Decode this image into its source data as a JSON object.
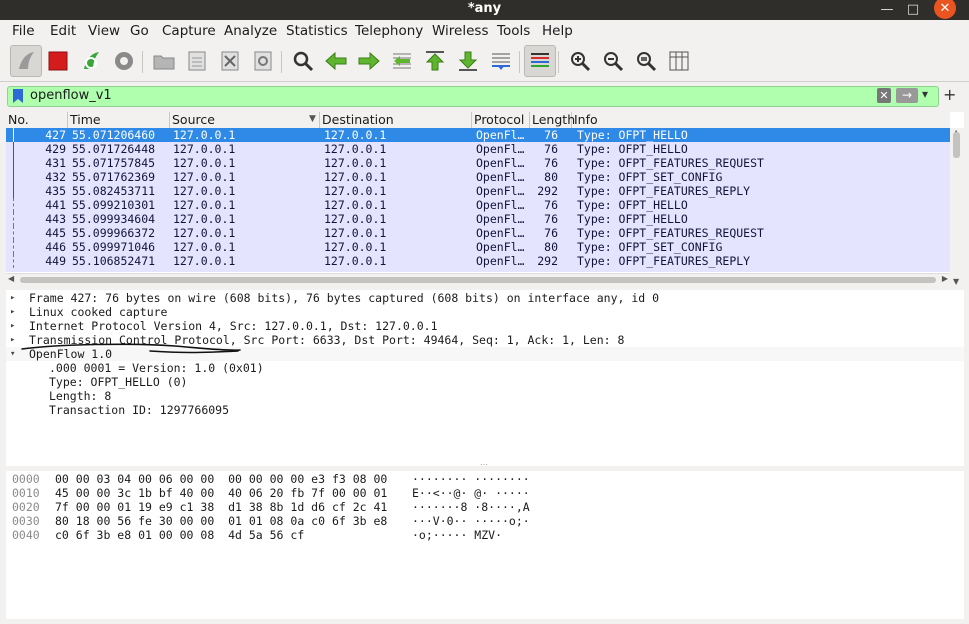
{
  "window": {
    "title": "*any",
    "minimize": "—",
    "maximize": "□",
    "close": "✕"
  },
  "menu": [
    "File",
    "Edit",
    "View",
    "Go",
    "Capture",
    "Analyze",
    "Statistics",
    "Telephony",
    "Wireless",
    "Tools",
    "Help"
  ],
  "filter": {
    "value": "openflow_v1",
    "clear_icon": "✕",
    "apply_icon": "→",
    "dropdown_icon": "▾",
    "add_icon": "+"
  },
  "columns": [
    "No.",
    "Time",
    "Source",
    "Destination",
    "Protocol",
    "Length",
    "Info"
  ],
  "packets": [
    {
      "no": "427",
      "time": "55.071206460",
      "src": "127.0.0.1",
      "dst": "127.0.0.1",
      "proto": "OpenFl…",
      "len": "76",
      "info": "Type: OFPT_HELLO",
      "selected": true
    },
    {
      "no": "429",
      "time": "55.071726448",
      "src": "127.0.0.1",
      "dst": "127.0.0.1",
      "proto": "OpenFl…",
      "len": "76",
      "info": "Type: OFPT_HELLO"
    },
    {
      "no": "431",
      "time": "55.071757845",
      "src": "127.0.0.1",
      "dst": "127.0.0.1",
      "proto": "OpenFl…",
      "len": "76",
      "info": "Type: OFPT_FEATURES_REQUEST"
    },
    {
      "no": "432",
      "time": "55.071762369",
      "src": "127.0.0.1",
      "dst": "127.0.0.1",
      "proto": "OpenFl…",
      "len": "80",
      "info": "Type: OFPT_SET_CONFIG"
    },
    {
      "no": "435",
      "time": "55.082453711",
      "src": "127.0.0.1",
      "dst": "127.0.0.1",
      "proto": "OpenFl…",
      "len": "292",
      "info": "Type: OFPT_FEATURES_REPLY"
    },
    {
      "no": "441",
      "time": "55.099210301",
      "src": "127.0.0.1",
      "dst": "127.0.0.1",
      "proto": "OpenFl…",
      "len": "76",
      "info": "Type: OFPT_HELLO"
    },
    {
      "no": "443",
      "time": "55.099934604",
      "src": "127.0.0.1",
      "dst": "127.0.0.1",
      "proto": "OpenFl…",
      "len": "76",
      "info": "Type: OFPT_HELLO"
    },
    {
      "no": "445",
      "time": "55.099966372",
      "src": "127.0.0.1",
      "dst": "127.0.0.1",
      "proto": "OpenFl…",
      "len": "76",
      "info": "Type: OFPT_FEATURES_REQUEST"
    },
    {
      "no": "446",
      "time": "55.099971046",
      "src": "127.0.0.1",
      "dst": "127.0.0.1",
      "proto": "OpenFl…",
      "len": "80",
      "info": "Type: OFPT_SET_CONFIG"
    },
    {
      "no": "449",
      "time": "55.106852471",
      "src": "127.0.0.1",
      "dst": "127.0.0.1",
      "proto": "OpenFl…",
      "len": "292",
      "info": "Type: OFPT_FEATURES_REPLY"
    }
  ],
  "details": [
    {
      "arrow": "▸",
      "text": "Frame 427: 76 bytes on wire (608 bits), 76 bytes captured (608 bits) on interface any, id 0"
    },
    {
      "arrow": "▸",
      "text": "Linux cooked capture"
    },
    {
      "arrow": "▸",
      "text": "Internet Protocol Version 4, Src: 127.0.0.1, Dst: 127.0.0.1"
    },
    {
      "arrow": "▸",
      "text": "Transmission Control Protocol, Src Port: 6633, Dst Port: 49464, Seq: 1, Ack: 1, Len: 8"
    },
    {
      "arrow": "▾",
      "text": "OpenFlow 1.0"
    },
    {
      "arrow": "",
      "text": ".000 0001 = Version: 1.0 (0x01)"
    },
    {
      "arrow": "",
      "text": "Type: OFPT_HELLO (0)"
    },
    {
      "arrow": "",
      "text": "Length: 8"
    },
    {
      "arrow": "",
      "text": "Transaction ID: 1297766095"
    }
  ],
  "bytes": [
    {
      "off": "0000",
      "hex": "00 00 03 04 00 06 00 00  00 00 00 00 e3 f3 08 00",
      "ascii": "········ ········"
    },
    {
      "off": "0010",
      "hex": "45 00 00 3c 1b bf 40 00  40 06 20 fb 7f 00 00 01",
      "ascii": "E··<··@· @· ·····"
    },
    {
      "off": "0020",
      "hex": "7f 00 00 01 19 e9 c1 38  d1 38 8b 1d d6 cf 2c 41",
      "ascii": "·······8 ·8····,A"
    },
    {
      "off": "0030",
      "hex": "80 18 00 56 fe 30 00 00  01 01 08 0a c0 6f 3b e8",
      "ascii": "···V·0·· ·····o;·"
    },
    {
      "off": "0040",
      "hex": "c0 6f 3b e8 01 00 00 08  4d 5a 56 cf",
      "ascii": "·o;····· MZV·"
    }
  ]
}
